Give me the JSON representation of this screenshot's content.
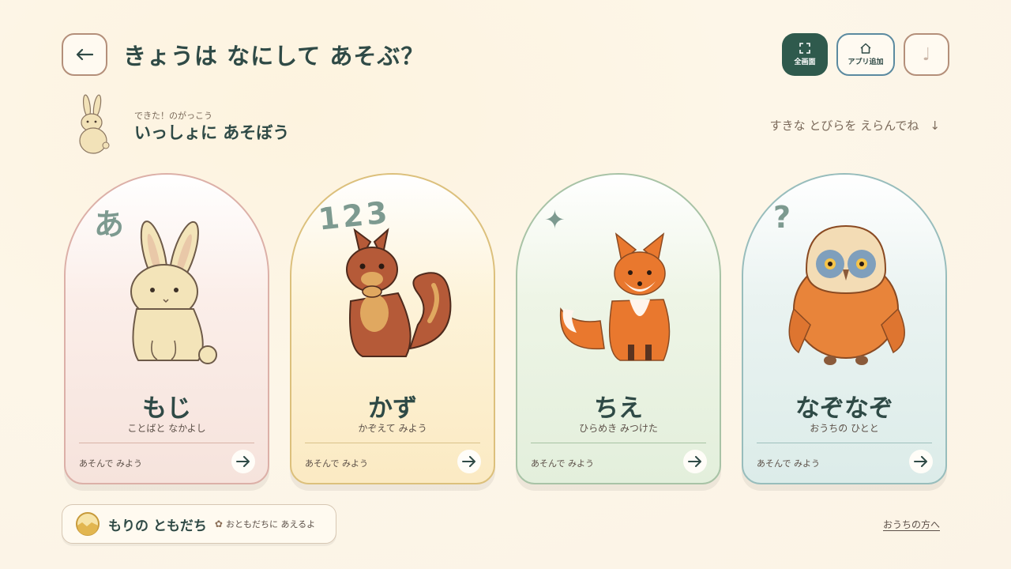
{
  "header": {
    "title": "きょうは なにして あそぶ？",
    "back_icon": "arrow-left-icon",
    "buttons": {
      "fullscreen_label": "全画面",
      "add_app_label": "アプリ追加",
      "music_icon": "♩"
    }
  },
  "subheader": {
    "small": "できた！のがっこう",
    "big": "いっしょに あそぼう",
    "hint": "すきな とびらを えらんでね",
    "hint_arrow": "↓"
  },
  "cards": [
    {
      "deco": "あ",
      "title": "もじ",
      "subtitle": "ことばと なかよし",
      "play": "あそんで みよう",
      "animal": "rabbit"
    },
    {
      "deco": "123",
      "title": "かず",
      "subtitle": "かぞえて みよう",
      "play": "あそんで みよう",
      "animal": "squirrel"
    },
    {
      "deco": "✦",
      "title": "ちえ",
      "subtitle": "ひらめき みつけた",
      "play": "あそんで みよう",
      "animal": "fox"
    },
    {
      "deco": "?",
      "title": "なぞなぞ",
      "subtitle": "おうちの ひとと",
      "play": "あそんで みよう",
      "animal": "owl"
    }
  ],
  "footer": {
    "friends_title": "もりの ともだち",
    "friends_flower": "✿",
    "friends_note": "おともだちに あえるよ",
    "parents_link": "おうちの方へ"
  },
  "colors": {
    "primary": "#2f5a4d",
    "text": "#2f4a46",
    "background": "#fdf6e8"
  }
}
